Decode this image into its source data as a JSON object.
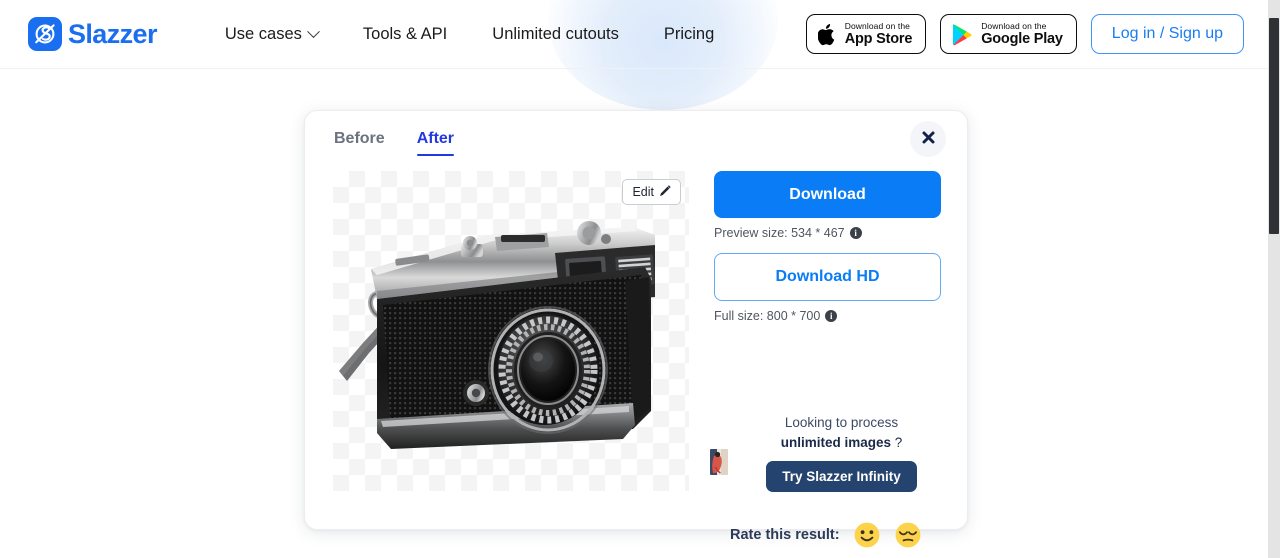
{
  "header": {
    "brand": {
      "name": "Slazzer",
      "logo_icon": "slazzer-logo-icon",
      "color": "#1a6ef0"
    },
    "nav": [
      {
        "label": "Use cases",
        "has_dropdown": true
      },
      {
        "label": "Tools & API",
        "has_dropdown": false
      },
      {
        "label": "Unlimited cutouts",
        "has_dropdown": false
      },
      {
        "label": "Pricing",
        "has_dropdown": false
      }
    ],
    "app_store": {
      "small": "Download on the",
      "big": "App Store",
      "icon": "apple-icon"
    },
    "google_play": {
      "small": "Download on the",
      "big": "Google Play",
      "icon": "google-play-icon"
    },
    "login": {
      "label": "Log in / Sign up",
      "color": "#1a7cf0"
    }
  },
  "modal": {
    "tabs": [
      {
        "label": "Before",
        "active": false
      },
      {
        "label": "After",
        "active": true
      }
    ],
    "close_icon": "close-icon",
    "preview": {
      "edit_label": "Edit",
      "edit_icon": "pencil-icon",
      "image_subject": "vintage-rangefinder-camera",
      "background": "transparent-checkerboard"
    },
    "download": {
      "primary_label": "Download",
      "primary_color": "#0a7cf6",
      "preview_size_label": "Preview size: 534 * 467",
      "hd_label": "Download HD",
      "full_size_label": "Full size: 800 * 700",
      "info_icon": "info-icon"
    },
    "promo": {
      "line1": "Looking to process",
      "line2_bold": "unlimited images",
      "line2_suffix": "?",
      "button_label": "Try Slazzer Infinity",
      "button_color": "#24436e",
      "thumbnail_icon": "promo-thumbnail-image"
    },
    "rating": {
      "label": "Rate this result:",
      "options": [
        {
          "icon": "smiling-face-emoji",
          "glyph": "🙂"
        },
        {
          "icon": "pensive-face-emoji",
          "glyph": "😌"
        }
      ]
    }
  },
  "scrollbar": {
    "position": "top",
    "thumb_color": "#2f3134"
  }
}
